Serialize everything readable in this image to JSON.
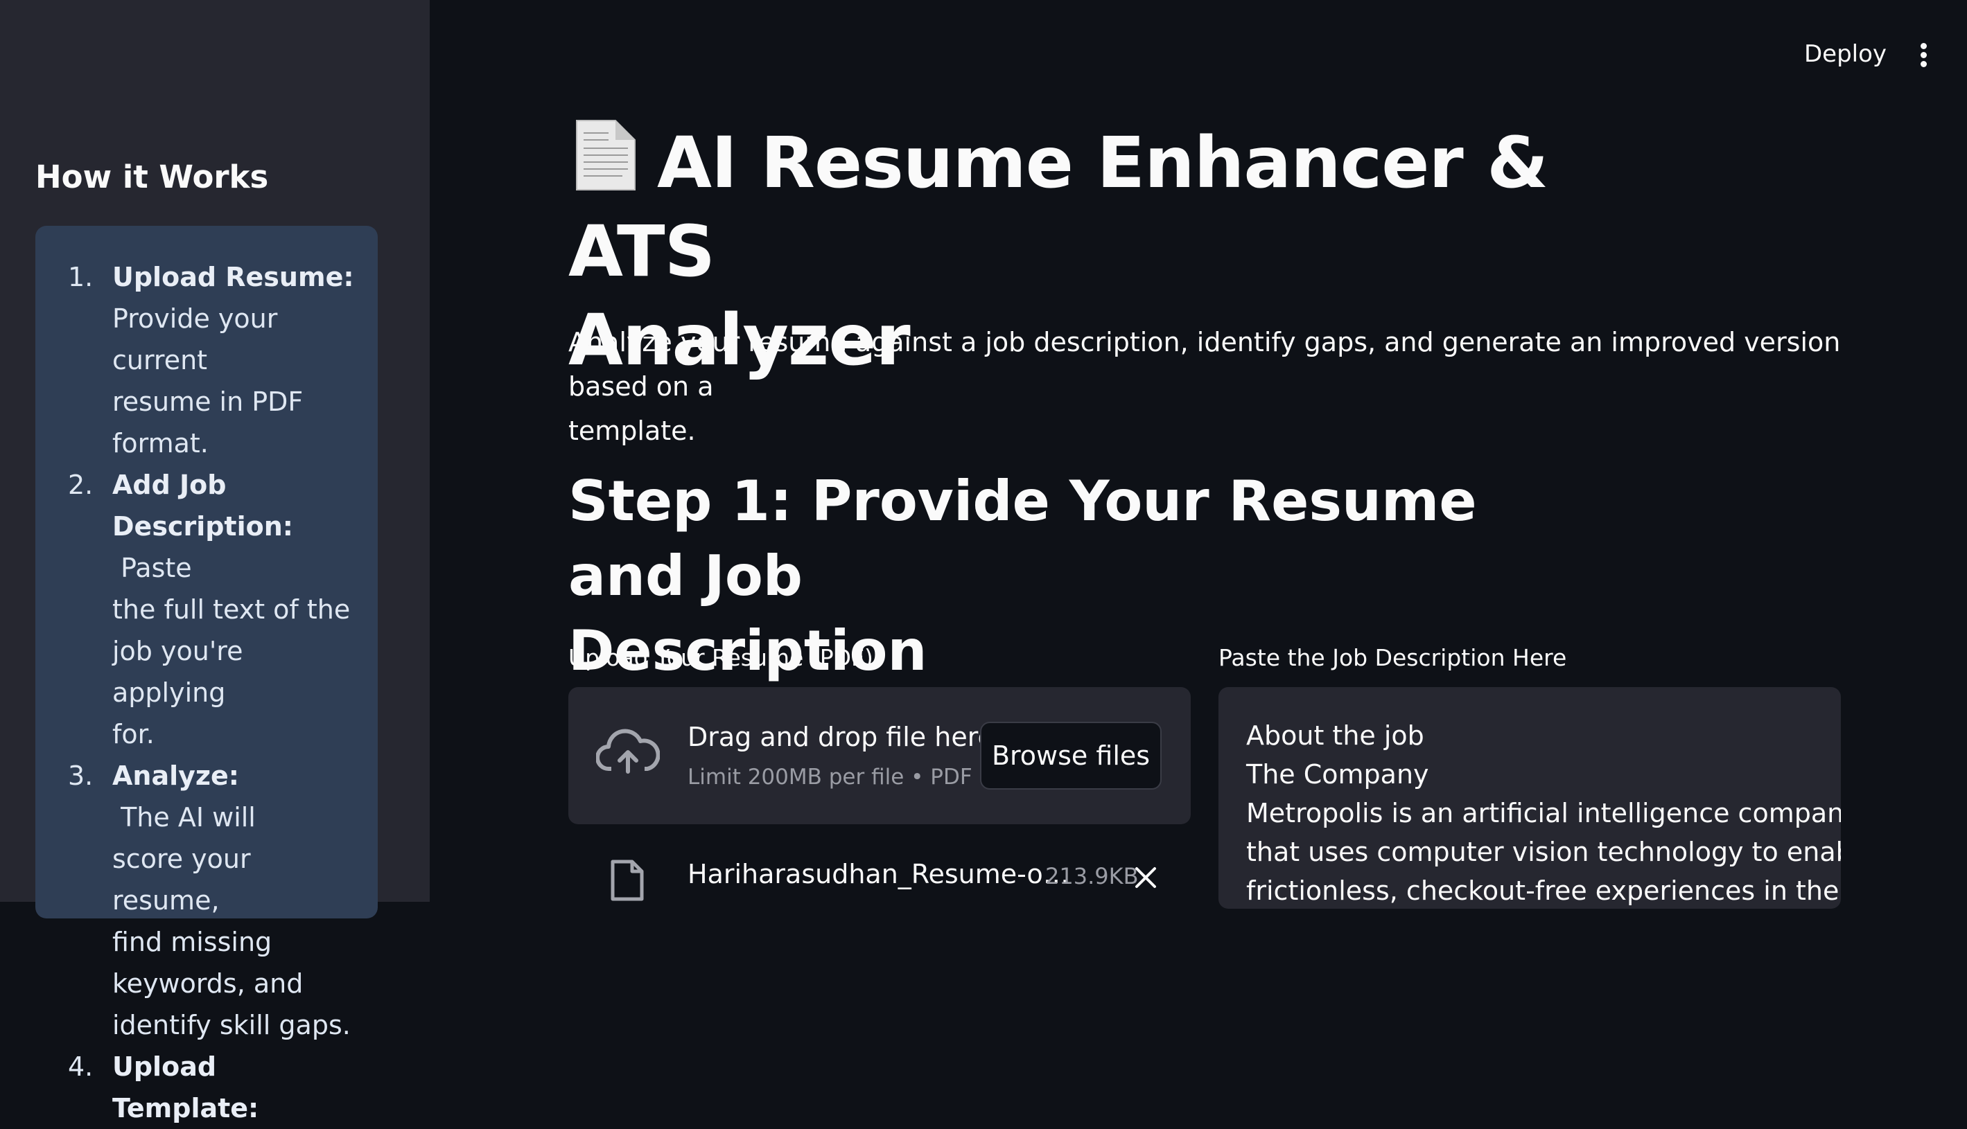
{
  "header": {
    "deploy_label": "Deploy",
    "menu_icon": "more-vertical-icon"
  },
  "sidebar": {
    "title": "How it Works",
    "steps": [
      {
        "num": "1.",
        "bold": "Upload Resume:",
        "lines": [
          "Provide your current",
          "resume in PDF",
          "format."
        ]
      },
      {
        "num": "2.",
        "bold_lines": [
          "Add Job",
          "Description:"
        ],
        "text_after": " Paste",
        "lines": [
          "the full text of the",
          "job you're applying",
          "for."
        ]
      },
      {
        "num": "3.",
        "bold": "Analyze:",
        "text_after": " The AI will",
        "lines": [
          "score your resume,",
          "find missing",
          "keywords, and",
          "identify skill gaps."
        ]
      },
      {
        "num": "4.",
        "bold": "Upload Template:"
      }
    ]
  },
  "main": {
    "title_icon": "document-icon",
    "title_line1": "AI Resume Enhancer & ATS",
    "title_line2": "Analyzer",
    "subtitle_line1": "Analyze your resume against a job description, identify gaps, and generate an improved version based on a",
    "subtitle_line2": "template.",
    "step1_line1": "Step 1: Provide Your Resume and Job",
    "step1_line2": "Description",
    "upload": {
      "label": "Upload Your Resume (PDF)",
      "dropzone_title": "Drag and drop file here",
      "dropzone_limit": "Limit 200MB per file • PDF",
      "browse_label": "Browse files",
      "file_name": "Hariharasudhan_Resume-o…",
      "file_size": "213.9KB"
    },
    "job_description": {
      "label": "Paste the Job Description Here",
      "lines": [
        "About the job",
        "The Company",
        "Metropolis is an artificial intelligence company",
        "that uses computer vision technology to enable",
        "frictionless, checkout-free experiences in the"
      ]
    }
  }
}
